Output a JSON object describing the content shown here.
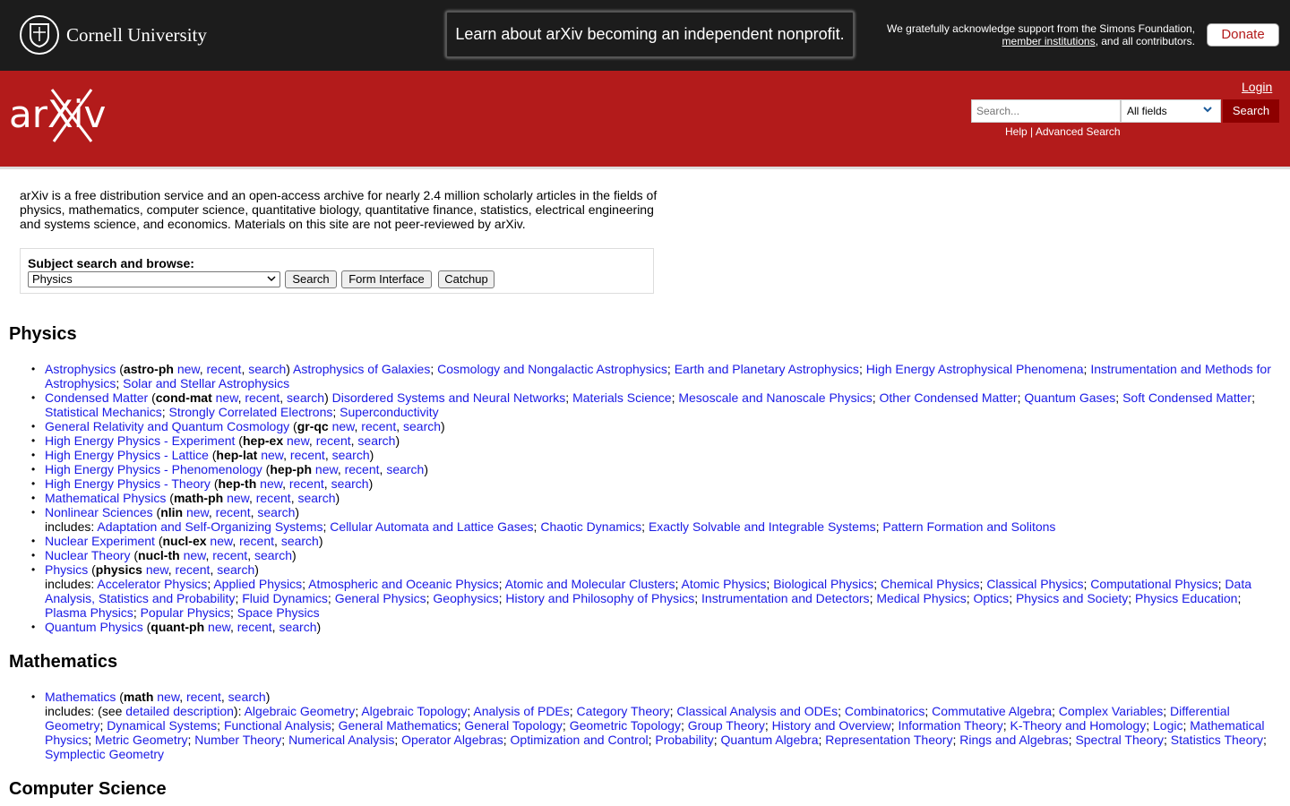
{
  "topbar": {
    "institution": "Cornell University",
    "banner": "Learn about arXiv becoming an independent nonprofit.",
    "ack_line1": "We gratefully acknowledge support from the Simons Foundation,",
    "ack_link": "member institutions",
    "ack_line2": ", and all contributors.",
    "donate": "Donate"
  },
  "header": {
    "logo_text": "arXiv",
    "login": "Login",
    "search_placeholder": "Search...",
    "field_selected": "All fields",
    "search_button": "Search",
    "help": "Help",
    "separator": " | ",
    "advanced": "Advanced Search"
  },
  "intro": "arXiv is a free distribution service and an open-access archive for nearly 2.4 million scholarly articles in the fields of physics, mathematics, computer science, quantitative biology, quantitative finance, statistics, electrical engineering and systems science, and economics. Materials on this site are not peer-reviewed by arXiv.",
  "subject_box": {
    "label": "Subject search and browse:",
    "selected": "Physics",
    "buttons": [
      "Search",
      "Form Interface",
      "Catchup"
    ]
  },
  "sections": [
    {
      "title": "Physics",
      "items": [
        {
          "name": "Astrophysics",
          "code": "astro-ph",
          "subs": [
            "Astrophysics of Galaxies",
            "Cosmology and Nongalactic Astrophysics",
            "Earth and Planetary Astrophysics",
            "High Energy Astrophysical Phenomena",
            "Instrumentation and Methods for Astrophysics",
            "Solar and Stellar Astrophysics"
          ],
          "sub_mode": "inline"
        },
        {
          "name": "Condensed Matter",
          "code": "cond-mat",
          "subs": [
            "Disordered Systems and Neural Networks",
            "Materials Science",
            "Mesoscale and Nanoscale Physics",
            "Other Condensed Matter",
            "Quantum Gases",
            "Soft Condensed Matter",
            "Statistical Mechanics",
            "Strongly Correlated Electrons",
            "Superconductivity"
          ],
          "sub_mode": "inline"
        },
        {
          "name": "General Relativity and Quantum Cosmology",
          "code": "gr-qc"
        },
        {
          "name": "High Energy Physics - Experiment",
          "code": "hep-ex"
        },
        {
          "name": "High Energy Physics - Lattice",
          "code": "hep-lat"
        },
        {
          "name": "High Energy Physics - Phenomenology",
          "code": "hep-ph"
        },
        {
          "name": "High Energy Physics - Theory",
          "code": "hep-th"
        },
        {
          "name": "Mathematical Physics",
          "code": "math-ph"
        },
        {
          "name": "Nonlinear Sciences",
          "code": "nlin",
          "subs": [
            "Adaptation and Self-Organizing Systems",
            "Cellular Automata and Lattice Gases",
            "Chaotic Dynamics",
            "Exactly Solvable and Integrable Systems",
            "Pattern Formation and Solitons"
          ],
          "sub_mode": "includes"
        },
        {
          "name": "Nuclear Experiment",
          "code": "nucl-ex"
        },
        {
          "name": "Nuclear Theory",
          "code": "nucl-th"
        },
        {
          "name": "Physics",
          "code": "physics",
          "subs": [
            "Accelerator Physics",
            "Applied Physics",
            "Atmospheric and Oceanic Physics",
            "Atomic and Molecular Clusters",
            "Atomic Physics",
            "Biological Physics",
            "Chemical Physics",
            "Classical Physics",
            "Computational Physics",
            "Data Analysis, Statistics and Probability",
            "Fluid Dynamics",
            "General Physics",
            "Geophysics",
            "History and Philosophy of Physics",
            "Instrumentation and Detectors",
            "Medical Physics",
            "Optics",
            "Physics and Society",
            "Physics Education",
            "Plasma Physics",
            "Popular Physics",
            "Space Physics"
          ],
          "sub_mode": "includes"
        },
        {
          "name": "Quantum Physics",
          "code": "quant-ph"
        }
      ]
    },
    {
      "title": "Mathematics",
      "items": [
        {
          "name": "Mathematics",
          "code": "math",
          "subs": [
            "Algebraic Geometry",
            "Algebraic Topology",
            "Analysis of PDEs",
            "Category Theory",
            "Classical Analysis and ODEs",
            "Combinatorics",
            "Commutative Algebra",
            "Complex Variables",
            "Differential Geometry",
            "Dynamical Systems",
            "Functional Analysis",
            "General Mathematics",
            "General Topology",
            "Geometric Topology",
            "Group Theory",
            "History and Overview",
            "Information Theory",
            "K-Theory and Homology",
            "Logic",
            "Mathematical Physics",
            "Metric Geometry",
            "Number Theory",
            "Numerical Analysis",
            "Operator Algebras",
            "Optimization and Control",
            "Probability",
            "Quantum Algebra",
            "Representation Theory",
            "Rings and Algebras",
            "Spectral Theory",
            "Statistics Theory",
            "Symplectic Geometry"
          ],
          "sub_mode": "detailed"
        }
      ]
    },
    {
      "title": "Computer Science",
      "items": []
    }
  ],
  "link_words": {
    "new": "new",
    "recent": "recent",
    "search": "search",
    "includes": "includes: ",
    "see": "(see ",
    "detailed": "detailed description",
    "close": "): "
  }
}
